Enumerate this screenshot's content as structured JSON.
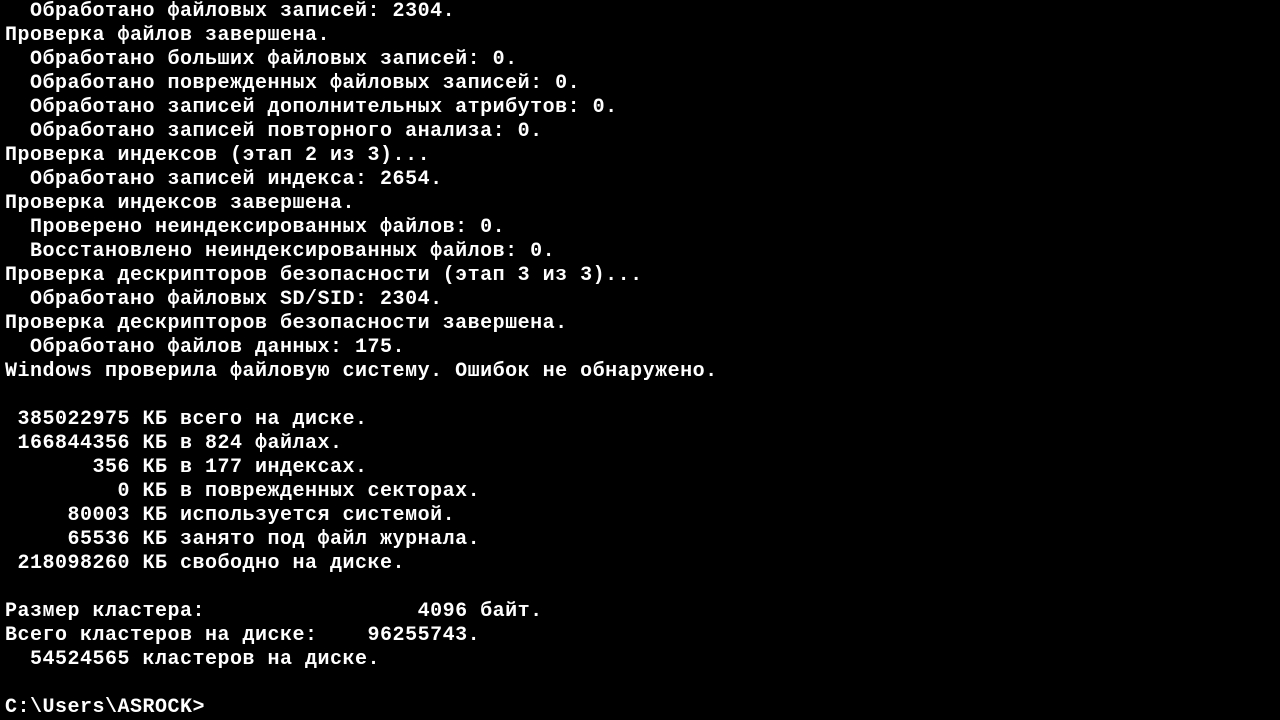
{
  "terminal": {
    "lines": [
      "  Обработано файловых записей: 2304.",
      "Проверка файлов завершена.",
      "  Обработано больших файловых записей: 0.",
      "  Обработано поврежденных файловых записей: 0.",
      "  Обработано записей дополнительных атрибутов: 0.",
      "  Обработано записей повторного анализа: 0.",
      "Проверка индексов (этап 2 из 3)...",
      "  Обработано записей индекса: 2654.",
      "Проверка индексов завершена.",
      "  Проверено неиндексированных файлов: 0.",
      "  Восстановлено неиндексированных файлов: 0.",
      "Проверка дескрипторов безопасности (этап 3 из 3)...",
      "  Обработано файловых SD/SID: 2304.",
      "Проверка дескрипторов безопасности завершена.",
      "  Обработано файлов данных: 175.",
      "Windows проверила файловую систему. Ошибок не обнаружено.",
      "",
      " 385022975 КБ всего на диске.",
      " 166844356 КБ в 824 файлах.",
      "       356 КБ в 177 индексах.",
      "         0 КБ в поврежденных секторах.",
      "     80003 КБ используется системой.",
      "     65536 КБ занято под файл журнала.",
      " 218098260 КБ свободно на диске.",
      "",
      "Размер кластера:                 4096 байт.",
      "Всего кластеров на диске:    96255743.",
      "  54524565 кластеров на диске.",
      ""
    ],
    "prompt": "C:\\Users\\ASROCK>"
  }
}
